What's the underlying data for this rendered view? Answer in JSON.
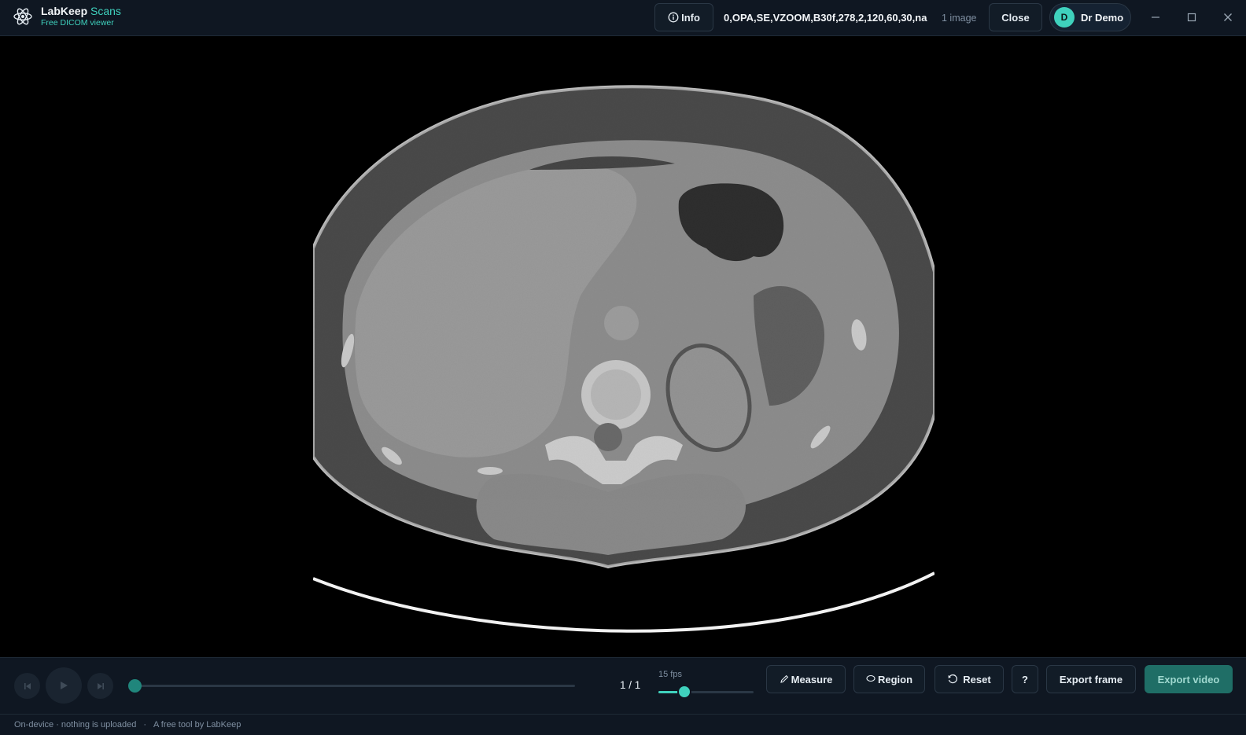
{
  "app": {
    "name": "LabKeep",
    "name_accent": "Scans",
    "subtitle": "Free DICOM viewer",
    "logo_icon": "atom-icon"
  },
  "header": {
    "info_label": "Info",
    "series_title": "0,OPA,SE,VZOOM,B30f,278,2,120,60,30,na",
    "image_count": "1 image",
    "close_label": "Close",
    "user_initial": "D",
    "user_name": "Dr Demo",
    "window_controls": [
      "minimize-icon",
      "maximize-icon",
      "close-icon"
    ]
  },
  "viewer": {
    "image_description_icon": "ct-axial-abdomen-slice"
  },
  "playback": {
    "frame_counter": "1 / 1",
    "fps_label": "15 fps",
    "fps_level": 0.27,
    "scrub_position": 0,
    "controls": [
      "skip-back-icon",
      "play-icon",
      "skip-forward-icon"
    ]
  },
  "tools": {
    "measure_label": "Measure",
    "region_label": "Region",
    "reset_label": "Reset",
    "help_label": "?",
    "export_frame_label": "Export frame",
    "export_video_label": "Export video"
  },
  "status": {
    "privacy": "On-device · nothing is uploaded",
    "credit": "A free tool by LabKeep"
  },
  "colors": {
    "accent": "#3fd1bd",
    "panel_bg": "#0f1722",
    "export_video_bg": "#1f6e66"
  }
}
